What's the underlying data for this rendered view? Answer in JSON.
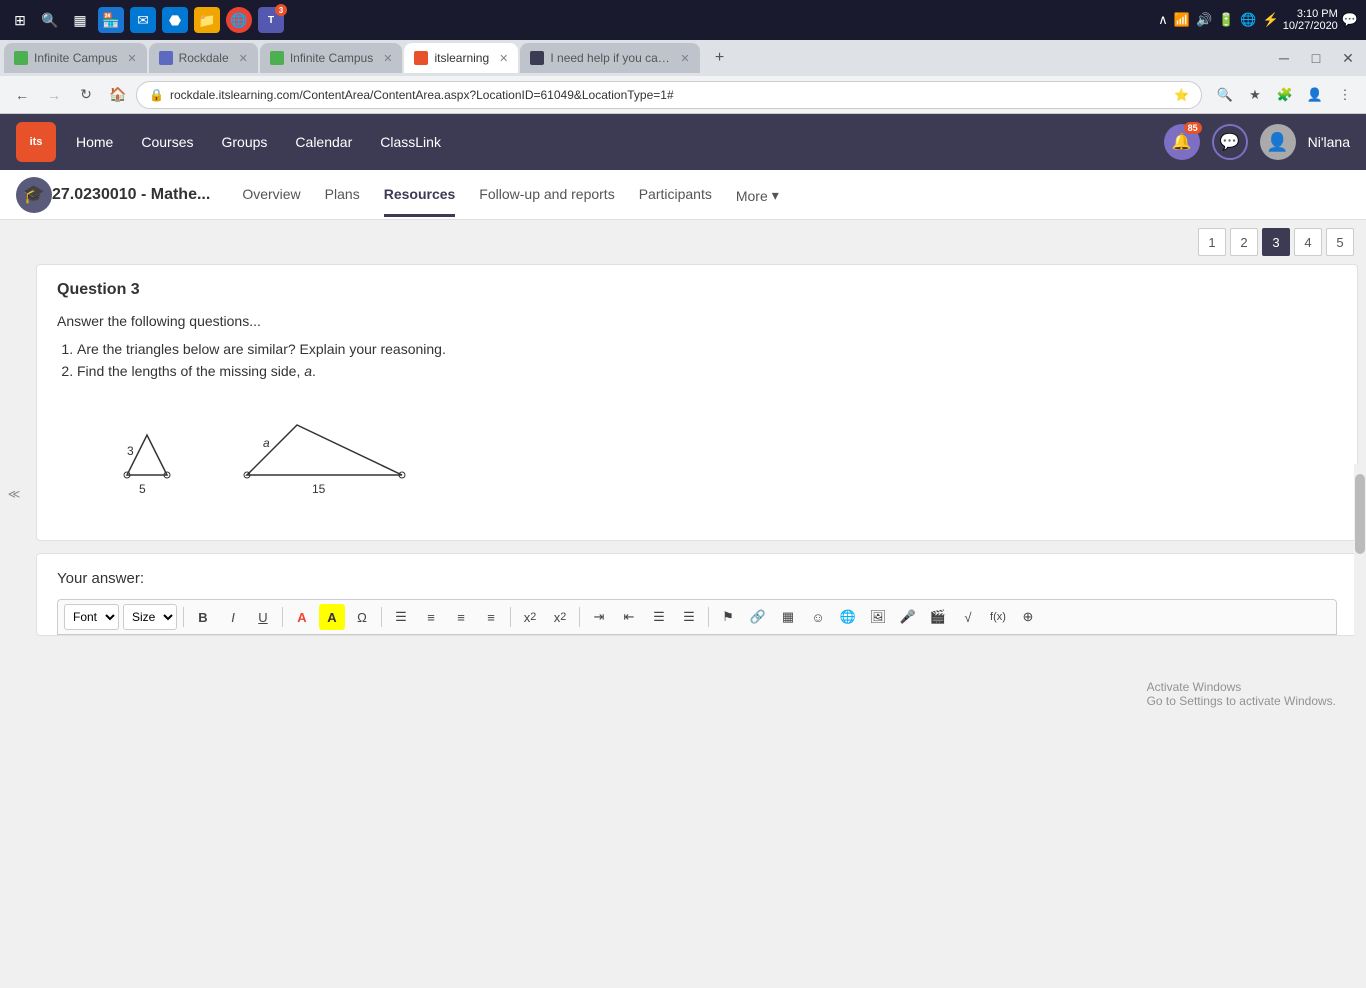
{
  "taskbar": {
    "time": "3:10 PM",
    "date": "10/27/2020",
    "icons": [
      "⊞",
      "🔍",
      "▦",
      "🏪",
      "✉",
      "⬣",
      "📁",
      "🌐",
      "🟠"
    ]
  },
  "browser": {
    "tabs": [
      {
        "label": "Infinite Campus",
        "active": false,
        "favicon_color": "#4caf50"
      },
      {
        "label": "Rockdale",
        "active": false,
        "favicon_color": "#5c6bc0"
      },
      {
        "label": "Infinite Campus",
        "active": false,
        "favicon_color": "#4caf50"
      },
      {
        "label": "itslearning",
        "active": true,
        "favicon_color": "#e8522a"
      },
      {
        "label": "I need help if you can help me",
        "active": false,
        "favicon_color": "#3d3a54"
      }
    ],
    "address": "rockdale.itslearning.com/ContentArea/ContentArea.aspx?LocationID=61049&LocationType=1#"
  },
  "nav": {
    "logo": "its",
    "links": [
      "Home",
      "Courses",
      "Groups",
      "Calendar",
      "ClassLink"
    ],
    "bell_count": "85",
    "username": "Ni'lana"
  },
  "course": {
    "title": "27.0230010 - Mathe...",
    "tabs": [
      "Overview",
      "Plans",
      "Resources",
      "Follow-up and reports",
      "Participants"
    ],
    "active_tab": "Resources",
    "more_label": "More"
  },
  "pagination": {
    "pages": [
      "1",
      "2",
      "3",
      "4",
      "5"
    ],
    "active_page": "3"
  },
  "question": {
    "title": "Question 3",
    "intro": "Answer the following questions...",
    "items": [
      "Are the triangles below are similar? Explain your reasoning.",
      "Find the lengths of the missing side, a."
    ]
  },
  "answer": {
    "label": "Your answer:"
  },
  "toolbar": {
    "font_label": "Font",
    "size_label": "Size",
    "buttons": [
      "B",
      "I",
      "U",
      "A",
      "A",
      "Ω",
      "≡",
      "≡",
      "≡",
      "≡",
      "x₂",
      "x²",
      "⬄",
      "⬄",
      "≡",
      "☰",
      "⚑",
      "🔗",
      "▦",
      "☺",
      "🌐",
      "🖼",
      "🎤",
      "🎬",
      "√",
      "⊕",
      "+"
    ]
  }
}
